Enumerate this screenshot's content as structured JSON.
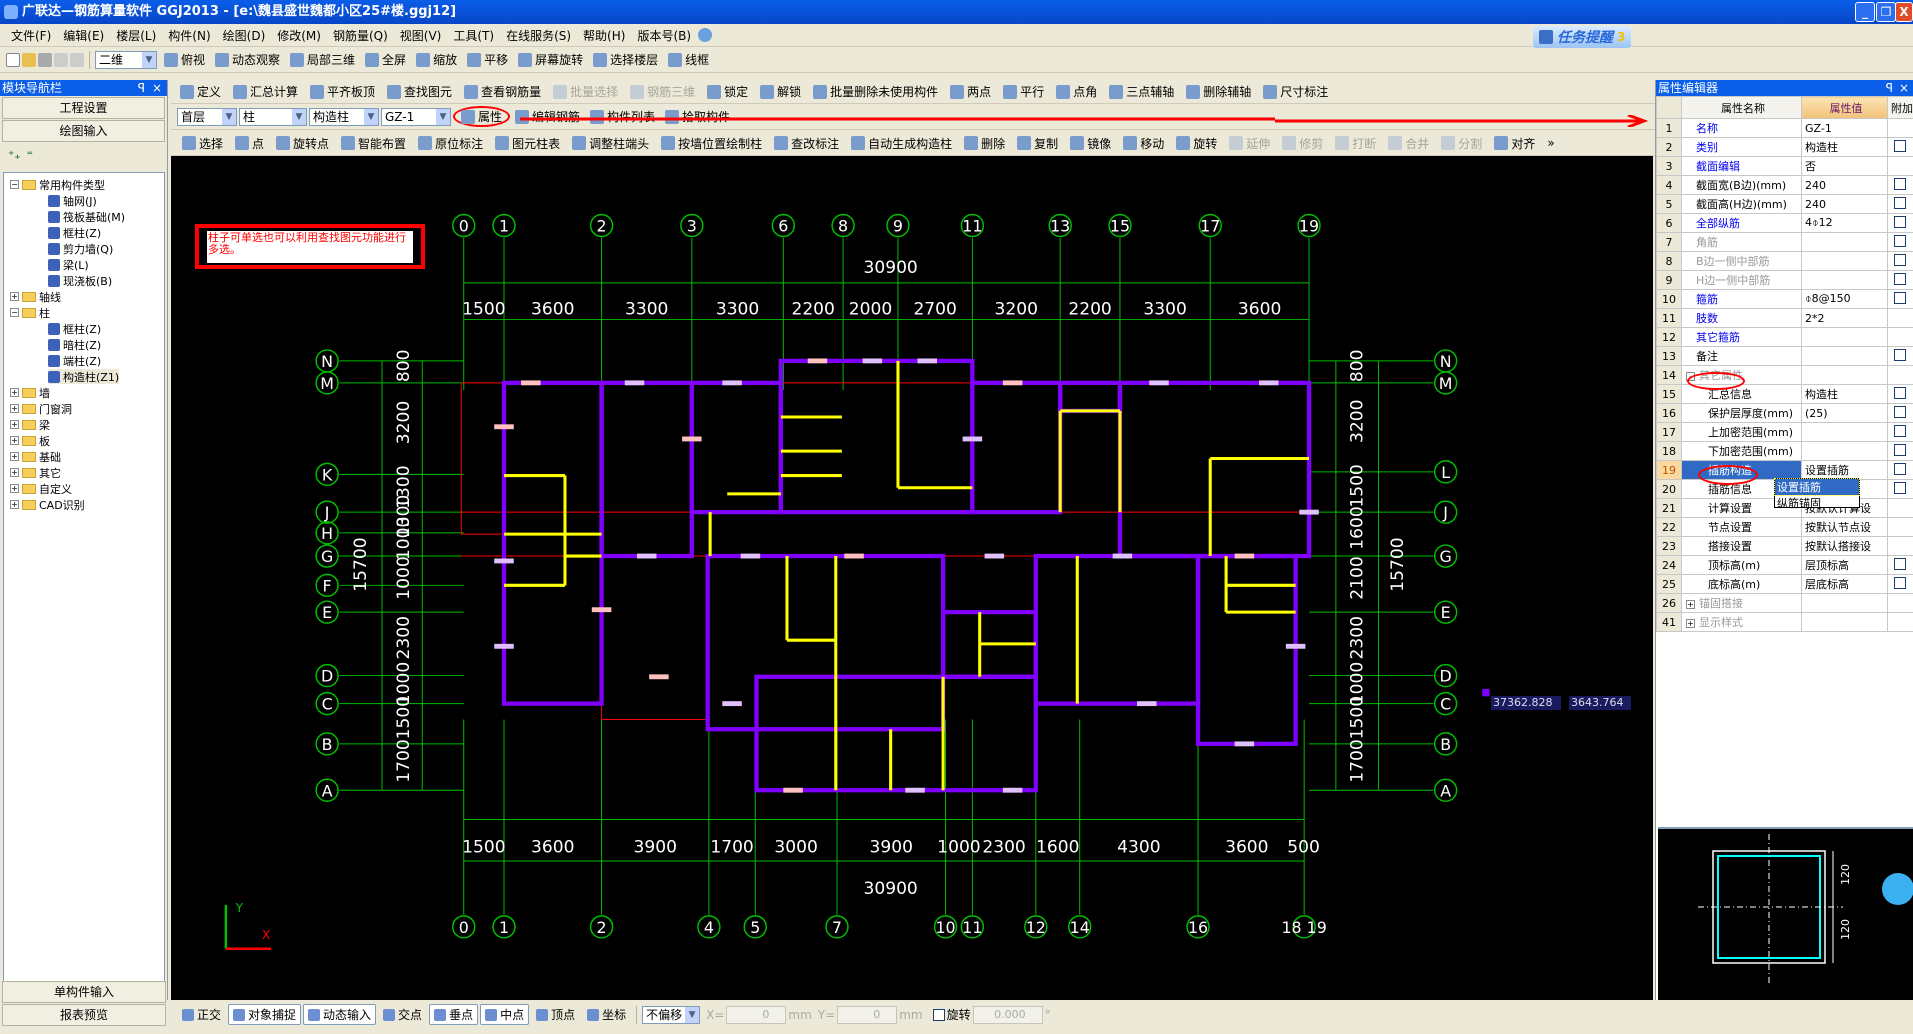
{
  "window": {
    "title": "广联达—钢筋算量软件 GGJ2013 - [e:\\魏县盛世魏都小区25#楼.ggj12]",
    "min": "_",
    "restore": "❐",
    "close": "X"
  },
  "menu": [
    "文件(F)",
    "编辑(E)",
    "楼层(L)",
    "构件(N)",
    "绘图(D)",
    "修改(M)",
    "钢筋量(Q)",
    "视图(V)",
    "工具(T)",
    "在线服务(S)",
    "帮助(H)",
    "版本号(B)"
  ],
  "task_reminder": {
    "label": "任务提醒",
    "count": "3"
  },
  "toolbar1": {
    "view_mode": "二维",
    "items": [
      "俯视",
      "动态观察",
      "局部三维",
      "全屏",
      "缩放",
      "平移",
      "屏幕旋转",
      "选择楼层",
      "线框"
    ]
  },
  "toolbar2": {
    "items": [
      {
        "label": "定义",
        "enabled": true
      },
      {
        "label": "汇总计算",
        "enabled": true
      },
      {
        "label": "平齐板顶",
        "enabled": true
      },
      {
        "label": "查找图元",
        "enabled": true
      },
      {
        "label": "查看钢筋量",
        "enabled": true
      },
      {
        "label": "批量选择",
        "enabled": false
      },
      {
        "label": "钢筋三维",
        "enabled": false
      },
      {
        "label": "锁定",
        "enabled": true
      },
      {
        "label": "解锁",
        "enabled": true
      },
      {
        "label": "批量删除未使用构件",
        "enabled": true
      },
      {
        "label": "两点",
        "enabled": true
      },
      {
        "label": "平行",
        "enabled": true
      },
      {
        "label": "点角",
        "enabled": true
      },
      {
        "label": "三点辅轴",
        "enabled": true
      },
      {
        "label": "删除辅轴",
        "enabled": true
      },
      {
        "label": "尺寸标注",
        "enabled": true
      }
    ]
  },
  "toolbar3": {
    "floor": "首层",
    "category": "柱",
    "type": "构造柱",
    "component": "GZ-1",
    "items": [
      "属性",
      "编辑钢筋",
      "构件列表",
      "拾取构件"
    ]
  },
  "toolbar4": {
    "items": [
      {
        "label": "选择",
        "enabled": true
      },
      {
        "label": "点",
        "enabled": true
      },
      {
        "label": "旋转点",
        "enabled": true
      },
      {
        "label": "智能布置",
        "enabled": true
      },
      {
        "label": "原位标注",
        "enabled": true
      },
      {
        "label": "图元柱表",
        "enabled": true
      },
      {
        "label": "调整柱端头",
        "enabled": true
      },
      {
        "label": "按墙位置绘制柱",
        "enabled": true
      },
      {
        "label": "查改标注",
        "enabled": true
      },
      {
        "label": "自动生成构造柱",
        "enabled": true
      },
      {
        "label": "删除",
        "enabled": true
      },
      {
        "label": "复制",
        "enabled": true
      },
      {
        "label": "镜像",
        "enabled": true
      },
      {
        "label": "移动",
        "enabled": true
      },
      {
        "label": "旋转",
        "enabled": true
      },
      {
        "label": "延伸",
        "enabled": false
      },
      {
        "label": "修剪",
        "enabled": false
      },
      {
        "label": "打断",
        "enabled": false
      },
      {
        "label": "合并",
        "enabled": false
      },
      {
        "label": "分割",
        "enabled": false
      },
      {
        "label": "对齐",
        "enabled": true
      }
    ],
    "more": "»"
  },
  "nav": {
    "title": "模块导航栏",
    "pin": "ꟼ",
    "close": "×",
    "top_buttons": [
      "工程设置",
      "绘图输入"
    ],
    "bottom_buttons": [
      "单构件输入",
      "报表预览"
    ],
    "tree": [
      {
        "label": "常用构件类型",
        "level": 0,
        "expanded": true
      },
      {
        "label": "轴网(J)",
        "level": 1
      },
      {
        "label": "筏板基础(M)",
        "level": 1
      },
      {
        "label": "框柱(Z)",
        "level": 1
      },
      {
        "label": "剪力墙(Q)",
        "level": 1
      },
      {
        "label": "梁(L)",
        "level": 1
      },
      {
        "label": "现浇板(B)",
        "level": 1
      },
      {
        "label": "轴线",
        "level": 0,
        "expanded": false
      },
      {
        "label": "柱",
        "level": 0,
        "expanded": true
      },
      {
        "label": "框柱(Z)",
        "level": 1
      },
      {
        "label": "暗柱(Z)",
        "level": 1
      },
      {
        "label": "端柱(Z)",
        "level": 1
      },
      {
        "label": "构造柱(Z1)",
        "level": 1,
        "selected": true
      },
      {
        "label": "墙",
        "level": 0,
        "expanded": false
      },
      {
        "label": "门窗洞",
        "level": 0,
        "expanded": false
      },
      {
        "label": "梁",
        "level": 0,
        "expanded": false
      },
      {
        "label": "板",
        "level": 0,
        "expanded": false
      },
      {
        "label": "基础",
        "level": 0,
        "expanded": false
      },
      {
        "label": "其它",
        "level": 0,
        "expanded": false
      },
      {
        "label": "自定义",
        "level": 0,
        "expanded": false
      },
      {
        "label": "CAD识别",
        "level": 0,
        "expanded": false
      }
    ]
  },
  "canvas": {
    "note": "柱子可单选也可以利用查找图元功能进行多选。",
    "coord_x": "37362.828",
    "coord_y": "3643.764",
    "axis_y": "Y",
    "axis_x": "X",
    "top_axes": [
      "0",
      "1",
      "2",
      "3",
      "6",
      "8",
      "9",
      "11",
      "13",
      "15",
      "17",
      "19"
    ],
    "bottom_axes": [
      "0",
      "1",
      "2",
      "4",
      "5",
      "7",
      "10",
      "11",
      "12",
      "14",
      "16",
      "18 19"
    ],
    "left_axes": [
      "N",
      "M",
      "K",
      "J",
      "H",
      "G",
      "F",
      "E",
      "D",
      "C",
      "B",
      "A"
    ],
    "right_axes": [
      "N",
      "M",
      "L",
      "J",
      "G",
      "E",
      "D",
      "C",
      "B",
      "A"
    ],
    "top_total": "30900",
    "bottom_total": "30900",
    "top_dims": [
      "1500",
      "3600",
      "3300",
      "3300",
      "2200",
      "2000",
      "2700",
      "3200",
      "2200",
      "3300",
      "3600"
    ],
    "bottom_dims": [
      "1500",
      "3600",
      "3900",
      "1700",
      "3000",
      "3900",
      "1000",
      "2300",
      "1600",
      "4300",
      "3600",
      "500"
    ],
    "left_total": "15700",
    "right_total": "15700",
    "left_dims": [
      "800",
      "3200",
      "1300",
      "1300",
      "1000",
      "1000",
      "2300",
      "1000",
      "1500",
      "1700"
    ],
    "right_dims": [
      "800",
      "3200",
      "1500",
      "1600",
      "2100",
      "2300",
      "1000",
      "1500",
      "1700"
    ]
  },
  "props": {
    "title": "属性编辑器",
    "pin": "ꟼ",
    "close": "×",
    "col_name": "属性名称",
    "col_value": "属性值",
    "col_extra": "附加",
    "rows": [
      {
        "n": "1",
        "name": "名称",
        "value": "GZ-1",
        "style": "blue",
        "check": false
      },
      {
        "n": "2",
        "name": "类别",
        "value": "构造柱",
        "style": "blue",
        "check": true
      },
      {
        "n": "3",
        "name": "截面编辑",
        "value": "否",
        "style": "blue",
        "check": false
      },
      {
        "n": "4",
        "name": "截面宽(B边)(mm)",
        "value": "240",
        "style": "",
        "check": true
      },
      {
        "n": "5",
        "name": "截面高(H边)(mm)",
        "value": "240",
        "style": "",
        "check": true
      },
      {
        "n": "6",
        "name": "全部纵筋",
        "value": "4⌽12",
        "style": "blue",
        "check": true
      },
      {
        "n": "7",
        "name": "角筋",
        "value": "",
        "style": "gray",
        "check": true
      },
      {
        "n": "8",
        "name": "B边一侧中部筋",
        "value": "",
        "style": "gray",
        "check": true
      },
      {
        "n": "9",
        "name": "H边一侧中部筋",
        "value": "",
        "style": "gray",
        "check": true
      },
      {
        "n": "10",
        "name": "箍筋",
        "value": "⌽8@150",
        "style": "blue",
        "check": true
      },
      {
        "n": "11",
        "name": "肢数",
        "value": "2*2",
        "style": "blue",
        "check": false
      },
      {
        "n": "12",
        "name": "其它箍筋",
        "value": "",
        "style": "blue",
        "check": false
      },
      {
        "n": "13",
        "name": "备注",
        "value": "",
        "style": "",
        "check": true
      },
      {
        "n": "14",
        "name": "其它属性",
        "value": "",
        "style": "gray",
        "check": false,
        "group": "-"
      },
      {
        "n": "15",
        "name": "汇总信息",
        "value": "构造柱",
        "style": "",
        "check": true,
        "child": true
      },
      {
        "n": "16",
        "name": "保护层厚度(mm)",
        "value": "(25)",
        "style": "",
        "check": true,
        "child": true
      },
      {
        "n": "17",
        "name": "上加密范围(mm)",
        "value": "",
        "style": "",
        "check": true,
        "child": true
      },
      {
        "n": "18",
        "name": "下加密范围(mm)",
        "value": "",
        "style": "",
        "check": true,
        "child": true
      },
      {
        "n": "19",
        "name": "插筋构造",
        "value": "设置插筋",
        "style": "",
        "check": true,
        "child": true,
        "selected": true
      },
      {
        "n": "20",
        "name": "插筋信息",
        "value": "",
        "style": "",
        "check": true,
        "child": true
      },
      {
        "n": "21",
        "name": "计算设置",
        "value": "按默认计算设",
        "style": "",
        "check": false,
        "child": true
      },
      {
        "n": "22",
        "name": "节点设置",
        "value": "按默认节点设",
        "style": "",
        "check": false,
        "child": true
      },
      {
        "n": "23",
        "name": "搭接设置",
        "value": "按默认搭接设",
        "style": "",
        "check": false,
        "child": true
      },
      {
        "n": "24",
        "name": "顶标高(m)",
        "value": "层顶标高",
        "style": "",
        "check": true,
        "child": true
      },
      {
        "n": "25",
        "name": "底标高(m)",
        "value": "层底标高",
        "style": "",
        "check": true,
        "child": true
      },
      {
        "n": "26",
        "name": "锚固搭接",
        "value": "",
        "style": "gray",
        "check": false,
        "group": "+"
      },
      {
        "n": "41",
        "name": "显示样式",
        "value": "",
        "style": "gray",
        "check": false,
        "group": "+"
      }
    ],
    "dropdown_options": [
      "设置插筋",
      "纵筋锚固"
    ],
    "preview_dims": [
      "120",
      "120",
      "120",
      "120"
    ]
  },
  "status": {
    "items": [
      {
        "label": "正交",
        "on": false
      },
      {
        "label": "对象捕捉",
        "on": true
      },
      {
        "label": "动态输入",
        "on": true
      },
      {
        "label": "交点",
        "on": false
      },
      {
        "label": "垂点",
        "on": true
      },
      {
        "label": "中点",
        "on": true
      },
      {
        "label": "顶点",
        "on": false
      },
      {
        "label": "坐标",
        "on": false
      }
    ],
    "offset_mode": "不偏移",
    "x_label": "X=",
    "x_value": "0",
    "y_label": "Y=",
    "y_value": "0",
    "unit": "mm",
    "rotate_label": "旋转",
    "rotate_value": "0.000",
    "degree": "°"
  },
  "colors": {
    "wall_purple": "#8000ff",
    "wall_yellow": "#ffff00",
    "axis_green": "#00c000",
    "axis_red": "#ff0000",
    "annotation": "#ff0000",
    "title_blue": "#0a5ee8"
  }
}
